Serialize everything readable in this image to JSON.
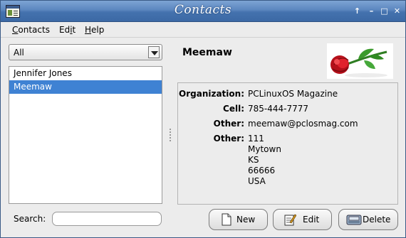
{
  "window": {
    "title": "Contacts"
  },
  "title_buttons": [
    {
      "name": "keep-above-button",
      "glyph": "↑"
    },
    {
      "name": "shade-button",
      "glyph": "–"
    },
    {
      "name": "maximize-button",
      "glyph": "□"
    },
    {
      "name": "close-button",
      "glyph": "✕"
    }
  ],
  "menu": {
    "contacts": {
      "label_pre": "",
      "mnemonic": "C",
      "label_post": "ontacts"
    },
    "edit": {
      "label_pre": "Ed",
      "mnemonic": "i",
      "label_post": "t"
    },
    "help": {
      "label_pre": "",
      "mnemonic": "H",
      "label_post": "elp"
    }
  },
  "filter": {
    "selected": "All"
  },
  "contacts": [
    {
      "name": "Jennifer Jones",
      "selected": false
    },
    {
      "name": "Meemaw",
      "selected": true
    }
  ],
  "search": {
    "label": "Search:",
    "value": ""
  },
  "contact": {
    "name": "Meemaw",
    "fields": {
      "organization": {
        "label": "Organization:",
        "value": "PCLinuxOS Magazine"
      },
      "cell": {
        "label": "Cell:",
        "value": "785-444-7777"
      },
      "other_email": {
        "label": "Other:",
        "value": "meemaw@pclosmag.com"
      },
      "other_address": {
        "label": "Other:",
        "lines": [
          "111",
          "Mytown",
          "KS",
          "66666",
          "USA"
        ]
      }
    }
  },
  "buttons": {
    "new": {
      "label": "New",
      "icon": "new-contact-icon"
    },
    "edit": {
      "label": "Edit",
      "icon": "edit-contact-icon"
    },
    "delete": {
      "label": "Delete",
      "icon": "delete-contact-icon"
    }
  },
  "colors": {
    "titlebar": "#4472ae",
    "selection": "#3f82d3",
    "window_bg": "#ececec"
  }
}
